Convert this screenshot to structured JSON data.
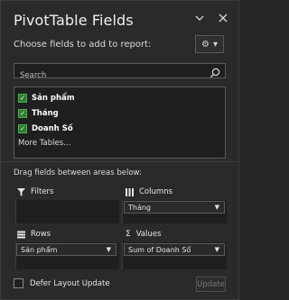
{
  "header": {
    "title": "PivotTable Fields"
  },
  "choose": {
    "label": "Choose fields to add to report:"
  },
  "search": {
    "placeholder": "Search"
  },
  "fields": [
    {
      "label": "Sản phẩm",
      "checked": true
    },
    {
      "label": "Tháng",
      "checked": true
    },
    {
      "label": "Doanh Số",
      "checked": true
    }
  ],
  "more_tables": "More Tables...",
  "areas_label": "Drag fields between areas below:",
  "areas": {
    "filters": {
      "label": "Filters"
    },
    "columns": {
      "label": "Columns",
      "item": "Tháng"
    },
    "rows": {
      "label": "Rows",
      "item": "Sản phẩm"
    },
    "values": {
      "label": "Values",
      "item": "Sum of Doanh Số"
    }
  },
  "footer": {
    "defer_label": "Defer Layout Update",
    "update_label": "Update"
  },
  "colors": {
    "check_green": "#2e7d32",
    "pane_bg": "#2a2a2a",
    "list_bg": "#1f1f1f"
  }
}
